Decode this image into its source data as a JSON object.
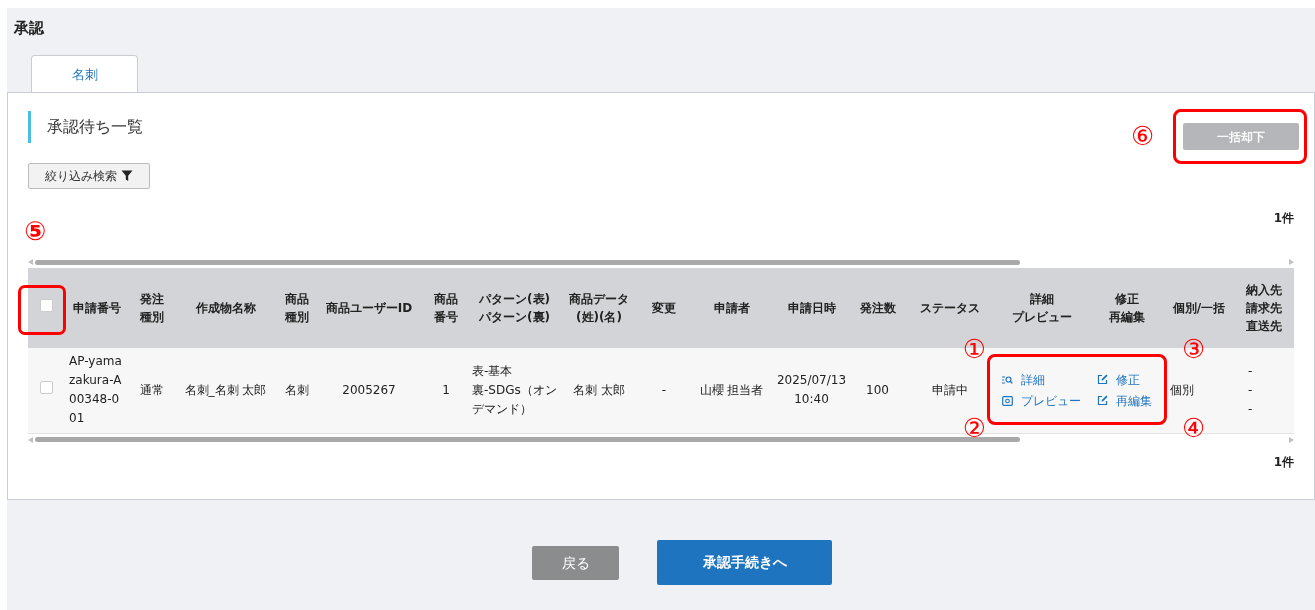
{
  "page_title": "承認",
  "tabs": [
    {
      "label": "名刺",
      "selected": true
    }
  ],
  "section_title": "承認待ち一覧",
  "filter_button": "絞り込み検索",
  "bulk_reject_button": {
    "label": "一括却下",
    "disabled": true,
    "highlighted": true,
    "callout": "⑥"
  },
  "count_top": "1件",
  "count_bottom": "1件",
  "table": {
    "select_all": {
      "checked": false,
      "highlighted": true,
      "callout": "⑤"
    },
    "columns": [
      {
        "lines": [
          "申請番号"
        ]
      },
      {
        "lines": [
          "発注",
          "種別"
        ]
      },
      {
        "lines": [
          "作成物名称"
        ]
      },
      {
        "lines": [
          "商品",
          "種別"
        ]
      },
      {
        "lines": [
          "商品ユーザーID"
        ]
      },
      {
        "lines": [
          "商品",
          "番号"
        ]
      },
      {
        "lines": [
          "パターン(表)",
          "パターン(裏)"
        ]
      },
      {
        "lines": [
          "商品データ",
          "(姓)(名)"
        ]
      },
      {
        "lines": [
          "変更"
        ]
      },
      {
        "lines": [
          "申請者"
        ]
      },
      {
        "lines": [
          "申請日時"
        ]
      },
      {
        "lines": [
          "発注数"
        ]
      },
      {
        "lines": [
          "ステータス"
        ]
      },
      {
        "lines": [
          "詳細",
          "プレビュー"
        ]
      },
      {
        "lines": [
          "修正",
          "再編集"
        ]
      },
      {
        "lines": [
          "個別/一括"
        ]
      },
      {
        "lines": [
          "納入先",
          "請求先",
          "直送先"
        ]
      }
    ],
    "rows": [
      {
        "checked": false,
        "links_highlighted": true,
        "callouts": [
          "①",
          "②",
          "③",
          "④"
        ],
        "cells": [
          {
            "kind": "text",
            "text": "AP-yamazakura-A00348-001"
          },
          {
            "kind": "text",
            "text": "通常"
          },
          {
            "kind": "text",
            "text": "名刺_名刺 太郎"
          },
          {
            "kind": "text",
            "text": "名刺"
          },
          {
            "kind": "text",
            "text": "2005267"
          },
          {
            "kind": "text",
            "text": "1"
          },
          {
            "kind": "lines",
            "lines": [
              "表-基本",
              "裏-SDGs（オンデマンド）"
            ]
          },
          {
            "kind": "text",
            "text": "名刺 太郎"
          },
          {
            "kind": "text",
            "text": "-"
          },
          {
            "kind": "text",
            "text": "山櫻 担当者"
          },
          {
            "kind": "text",
            "text": "2025/07/13\n10:40"
          },
          {
            "kind": "text",
            "text": "100"
          },
          {
            "kind": "text",
            "text": "申請中"
          },
          {
            "kind": "links",
            "links": [
              {
                "kind": "detail",
                "label": "詳細"
              },
              {
                "kind": "preview",
                "label": "プレビュー"
              }
            ]
          },
          {
            "kind": "links",
            "links": [
              {
                "kind": "edit",
                "label": "修正"
              },
              {
                "kind": "edit",
                "label": "再編集"
              }
            ]
          },
          {
            "kind": "text",
            "text": "個別"
          },
          {
            "kind": "text",
            "text": "-\n-\n-"
          }
        ]
      }
    ]
  },
  "footer_buttons": [
    {
      "kind": "secondary",
      "label": "戻る"
    },
    {
      "kind": "primary",
      "label": "承認手続きへ"
    }
  ]
}
